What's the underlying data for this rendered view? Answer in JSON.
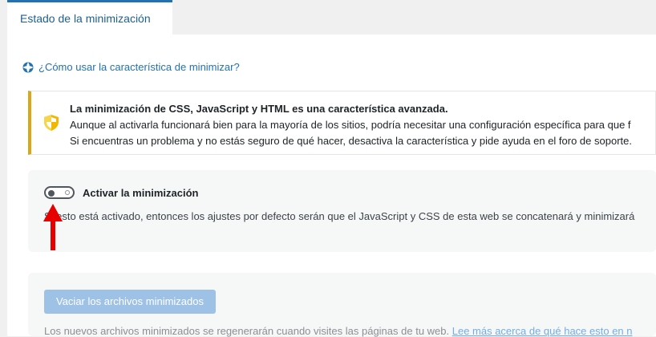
{
  "tab": {
    "label": "Estado de la minimización"
  },
  "help": {
    "link": "¿Cómo usar la característica de minimizar?",
    "icon": "lifebuoy-icon"
  },
  "notice": {
    "title": "La minimización de CSS, JavaScript y HTML es una característica avanzada.",
    "line1": "Aunque al activarla funcionará bien para la mayoría de los sitios, podría necesitar una configuración específica para que f",
    "line2": "Si encuentras un problema y no estás seguro de qué hacer, desactiva la característica y pide ayuda en el foro de soporte.",
    "icon": "shield-icon",
    "accent": "#dba617"
  },
  "setting": {
    "label": "Activar la minimización",
    "enabled": false,
    "description": "Si esto está activado, entonces los ajustes por defecto serán que el JavaScript y CSS de esta web se concatenará y minimizará"
  },
  "action": {
    "button": "Vaciar los archivos minimizados",
    "footer_text": "Los nuevos archivos minimizados se regenerarán cuando visites las páginas de tu web. ",
    "footer_link": "Lee más acerca de qué hace esto en n"
  },
  "colors": {
    "link": "#2271b1",
    "arrow": "#e60000",
    "button": "#9ec2e6"
  }
}
